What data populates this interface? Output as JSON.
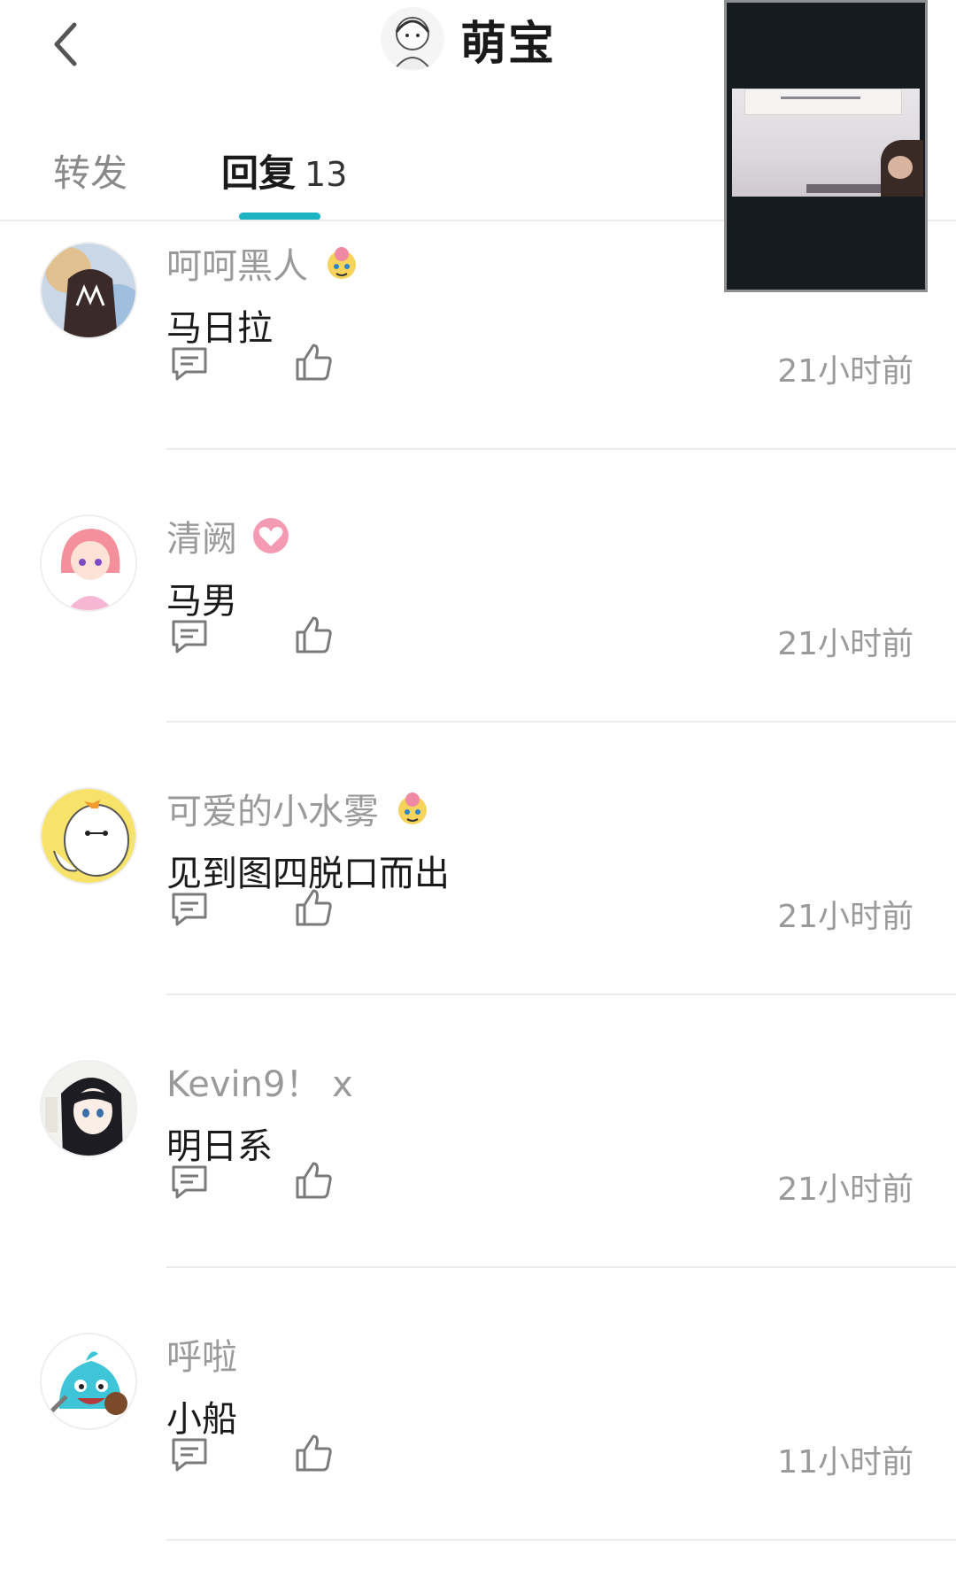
{
  "header": {
    "back_icon": "chevron-left-icon",
    "title": "萌宝"
  },
  "tabs": [
    {
      "label": "转发"
    },
    {
      "label": "回复",
      "count": "13"
    }
  ],
  "colors": {
    "accent": "#1bb3c2",
    "username": "#9a9a9a",
    "text": "#1a1a1a",
    "divider": "#ececec"
  },
  "replies": [
    {
      "username": "呵呵黑人",
      "content": "马日拉",
      "time": "21小时前",
      "badge": "cartoon-badge-icon"
    },
    {
      "username": "清阙",
      "content": "马男",
      "time": "21小时前",
      "badge": "pink-heart-badge-icon"
    },
    {
      "username": "可爱的小水雾",
      "content": "见到图四脱口而出",
      "time": "21小时前",
      "badge": "cartoon-badge-icon"
    },
    {
      "username": "Kevin9！ x",
      "content": "明日系",
      "time": "21小时前"
    },
    {
      "username": "呼啦",
      "content": "小船",
      "time": "11小时前"
    }
  ],
  "icons": {
    "comment": "comment-icon",
    "like": "thumbs-up-icon"
  }
}
